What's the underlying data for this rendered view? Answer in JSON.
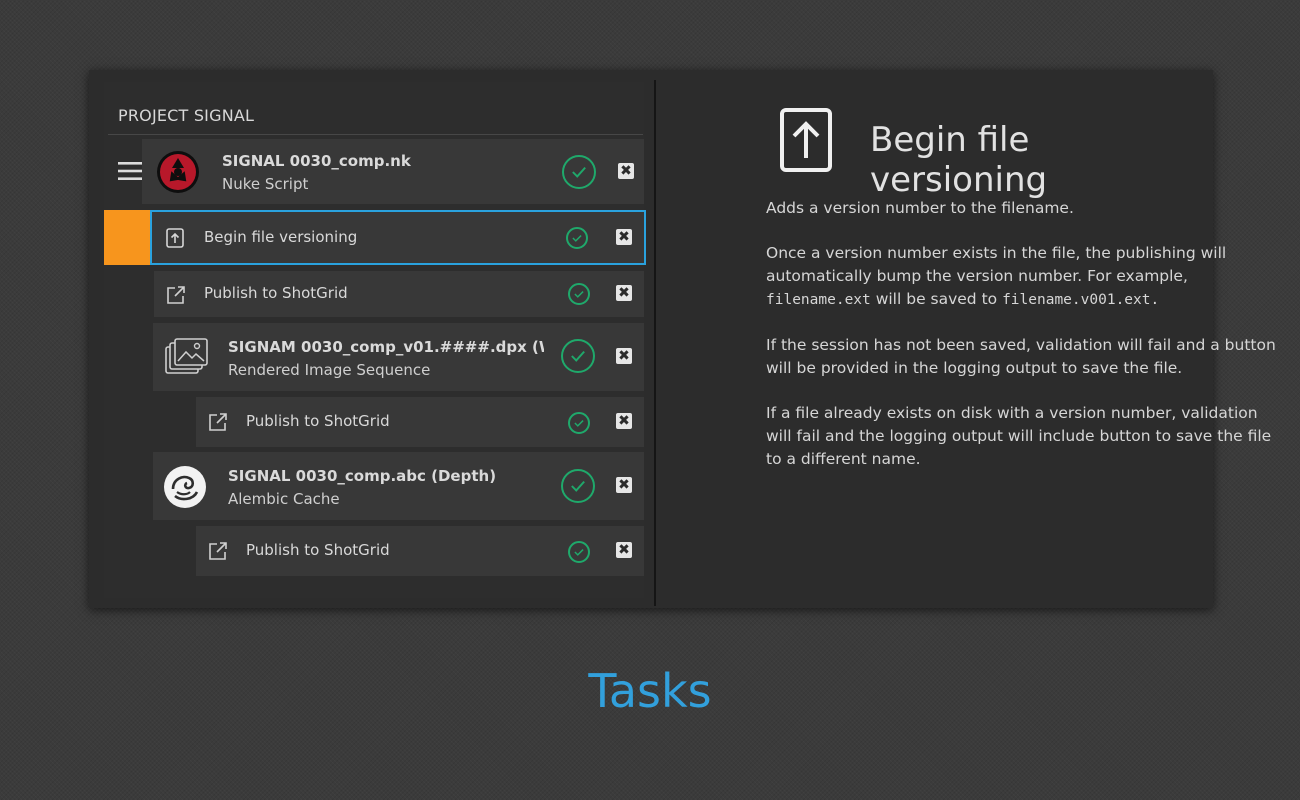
{
  "project": {
    "title": "PROJECT SIGNAL"
  },
  "tree": {
    "items": [
      {
        "title": "SIGNAL 0030_comp.nk",
        "subtitle": "Nuke Script",
        "icon": "nuke-icon"
      },
      {
        "label": "Begin file versioning",
        "icon": "upload-icon",
        "selected": true
      },
      {
        "label": "Publish to ShotGrid",
        "icon": "external-link-icon"
      },
      {
        "title": "SIGNAM 0030_comp_v01.####.dpx (Wı",
        "subtitle": "Rendered Image Sequence",
        "icon": "image-sequence-icon"
      },
      {
        "label": "Publish to ShotGrid",
        "icon": "external-link-icon"
      },
      {
        "title": "SIGNAL 0030_comp.abc (Depth)",
        "subtitle": "Alembic Cache",
        "icon": "alembic-icon"
      },
      {
        "label": "Publish to ShotGrid",
        "icon": "external-link-icon"
      }
    ]
  },
  "detail": {
    "heading": "Begin file versioning",
    "p1": "Adds a version number to the filename.",
    "p2_a": "Once a version number exists in the file, the publishing will automatically bump the version number. For example,",
    "p2_code1": "filename.ext",
    "p2_b": "will be saved to",
    "p2_code2": "filename.v001.ext.",
    "p3": "If the session has not been saved, validation will fail and a button will be provided in the logging output to save the file.",
    "p4": "If a file already exists on disk with a version number, validation will fail and the logging output will include button to save the file to a different name."
  },
  "footer": {
    "title": "Tasks"
  },
  "colors": {
    "accent": "#f7951d",
    "selection": "#2aa2de",
    "success": "#1fa96b",
    "footer": "#32a0dc"
  }
}
